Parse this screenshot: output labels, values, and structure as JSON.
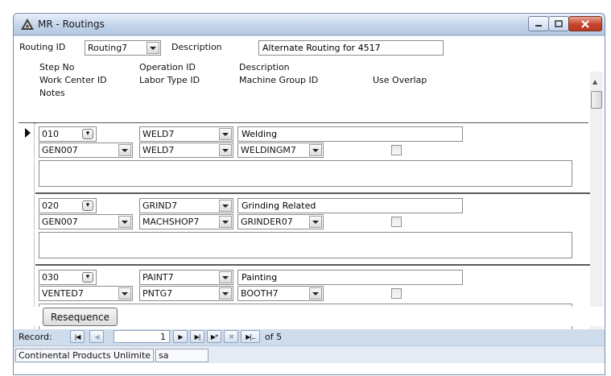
{
  "window": {
    "title": "MR - Routings"
  },
  "header": {
    "routing_id_label": "Routing ID",
    "routing_id_value": "Routing7",
    "description_label": "Description",
    "description_value": "Alternate Routing for 4517"
  },
  "columns": {
    "row1": [
      "Step No",
      "Operation ID",
      "Description"
    ],
    "row2": [
      "Work Center ID",
      "Labor Type ID",
      "Machine Group ID",
      "Use Overlap"
    ],
    "row3": [
      "Notes"
    ]
  },
  "records": [
    {
      "step_no": "010",
      "operation_id": "WELD7",
      "description": "Welding",
      "work_center_id": "GEN007",
      "labor_type_id": "WELD7",
      "machine_group_id": "WELDINGM7",
      "use_overlap": false,
      "notes": ""
    },
    {
      "step_no": "020",
      "operation_id": "GRIND7",
      "description": "Grinding Related",
      "work_center_id": "GEN007",
      "labor_type_id": "MACHSHOP7",
      "machine_group_id": "GRINDER07",
      "use_overlap": false,
      "notes": ""
    },
    {
      "step_no": "030",
      "operation_id": "PAINT7",
      "description": "Painting",
      "work_center_id": "VENTED7",
      "labor_type_id": "PNTG7",
      "machine_group_id": "BOOTH7",
      "use_overlap": false,
      "notes": ""
    }
  ],
  "buttons": {
    "resequence": "Resequence"
  },
  "navigation": {
    "record_label": "Record:",
    "current_record": "1",
    "of_text": "of 5",
    "first_glyph": "|◀",
    "prev_glyph": "◀",
    "next_glyph": "▶",
    "last_glyph": "▶|",
    "new_glyph": "▶*",
    "delete_glyph": "✖",
    "filter_glyph": "▶|..."
  },
  "status_bar": {
    "company": "Continental Products Unlimite",
    "user": "sa"
  },
  "colors": {
    "titlebar": "#c3d4ea",
    "close_button": "#c4442b",
    "form_background": "#ffffff",
    "nav_background": "#cfdcec"
  }
}
